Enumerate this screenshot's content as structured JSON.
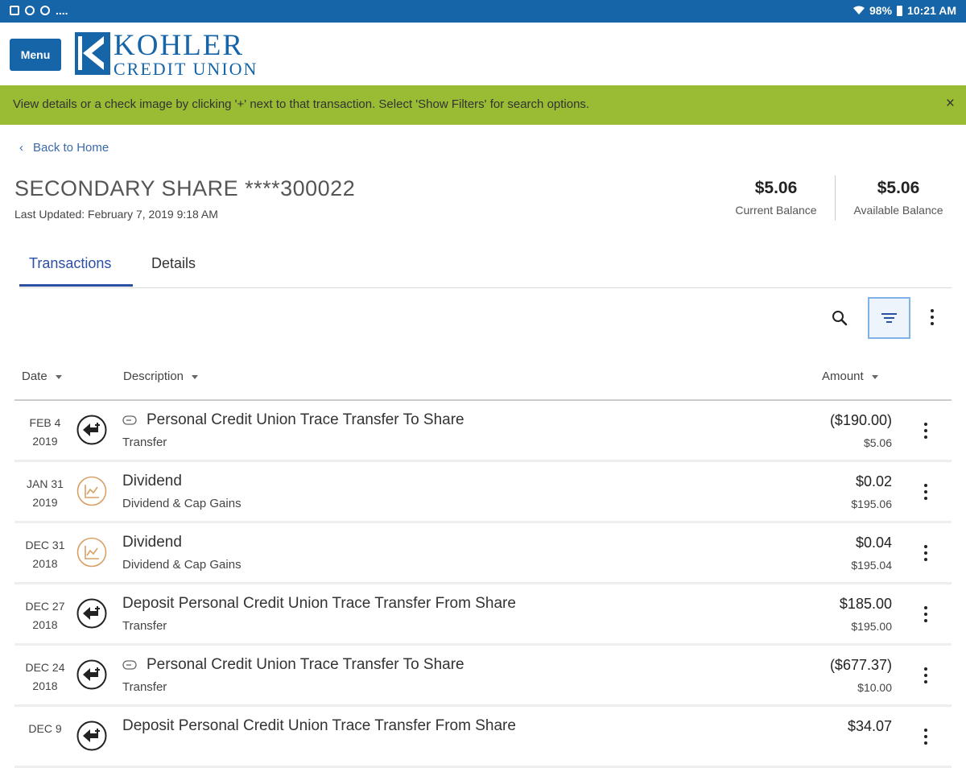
{
  "status_bar": {
    "left_text": "....",
    "battery": "98%",
    "time": "10:21 AM"
  },
  "header": {
    "menu_label": "Menu",
    "logo_line1": "KOHLER",
    "logo_line2": "CREDIT UNION",
    "brand_color": "#1565a8"
  },
  "banner": {
    "text": "View details or a check image by clicking '+' next to that transaction. Select 'Show Filters' for search options.",
    "close": "×",
    "color": "#99bc34"
  },
  "nav": {
    "back_label": "Back to Home"
  },
  "account": {
    "title": "SECONDARY SHARE ****300022",
    "last_updated": "Last Updated: February 7, 2019 9:18 AM",
    "current_balance": "$5.06",
    "current_balance_label": "Current Balance",
    "available_balance": "$5.06",
    "available_balance_label": "Available Balance"
  },
  "tabs": [
    {
      "label": "Transactions",
      "active": true
    },
    {
      "label": "Details",
      "active": false
    }
  ],
  "columns": {
    "date": "Date",
    "description": "Description",
    "amount": "Amount"
  },
  "transactions": [
    {
      "month_day": "FEB 4",
      "year": "2019",
      "icon": "transfer-icon",
      "tagged": true,
      "description": "Personal Credit Union Trace Transfer To Share",
      "category": "Transfer",
      "amount": "($190.00)",
      "balance": "$5.06"
    },
    {
      "month_day": "JAN 31",
      "year": "2019",
      "icon": "dividend-icon",
      "tagged": false,
      "description": "Dividend",
      "category": "Dividend & Cap Gains",
      "amount": "$0.02",
      "balance": "$195.06"
    },
    {
      "month_day": "DEC 31",
      "year": "2018",
      "icon": "dividend-icon",
      "tagged": false,
      "description": "Dividend",
      "category": "Dividend & Cap Gains",
      "amount": "$0.04",
      "balance": "$195.04"
    },
    {
      "month_day": "DEC 27",
      "year": "2018",
      "icon": "transfer-icon",
      "tagged": false,
      "description": "Deposit Personal Credit Union Trace Transfer From Share",
      "category": "Transfer",
      "amount": "$185.00",
      "balance": "$195.00"
    },
    {
      "month_day": "DEC 24",
      "year": "2018",
      "icon": "transfer-icon",
      "tagged": true,
      "description": "Personal Credit Union Trace Transfer To Share",
      "category": "Transfer",
      "amount": "($677.37)",
      "balance": "$10.00"
    },
    {
      "month_day": "DEC 9",
      "year": "",
      "icon": "transfer-icon",
      "tagged": false,
      "description": "Deposit Personal Credit Union Trace Transfer From Share",
      "category": "",
      "amount": "$34.07",
      "balance": ""
    }
  ]
}
